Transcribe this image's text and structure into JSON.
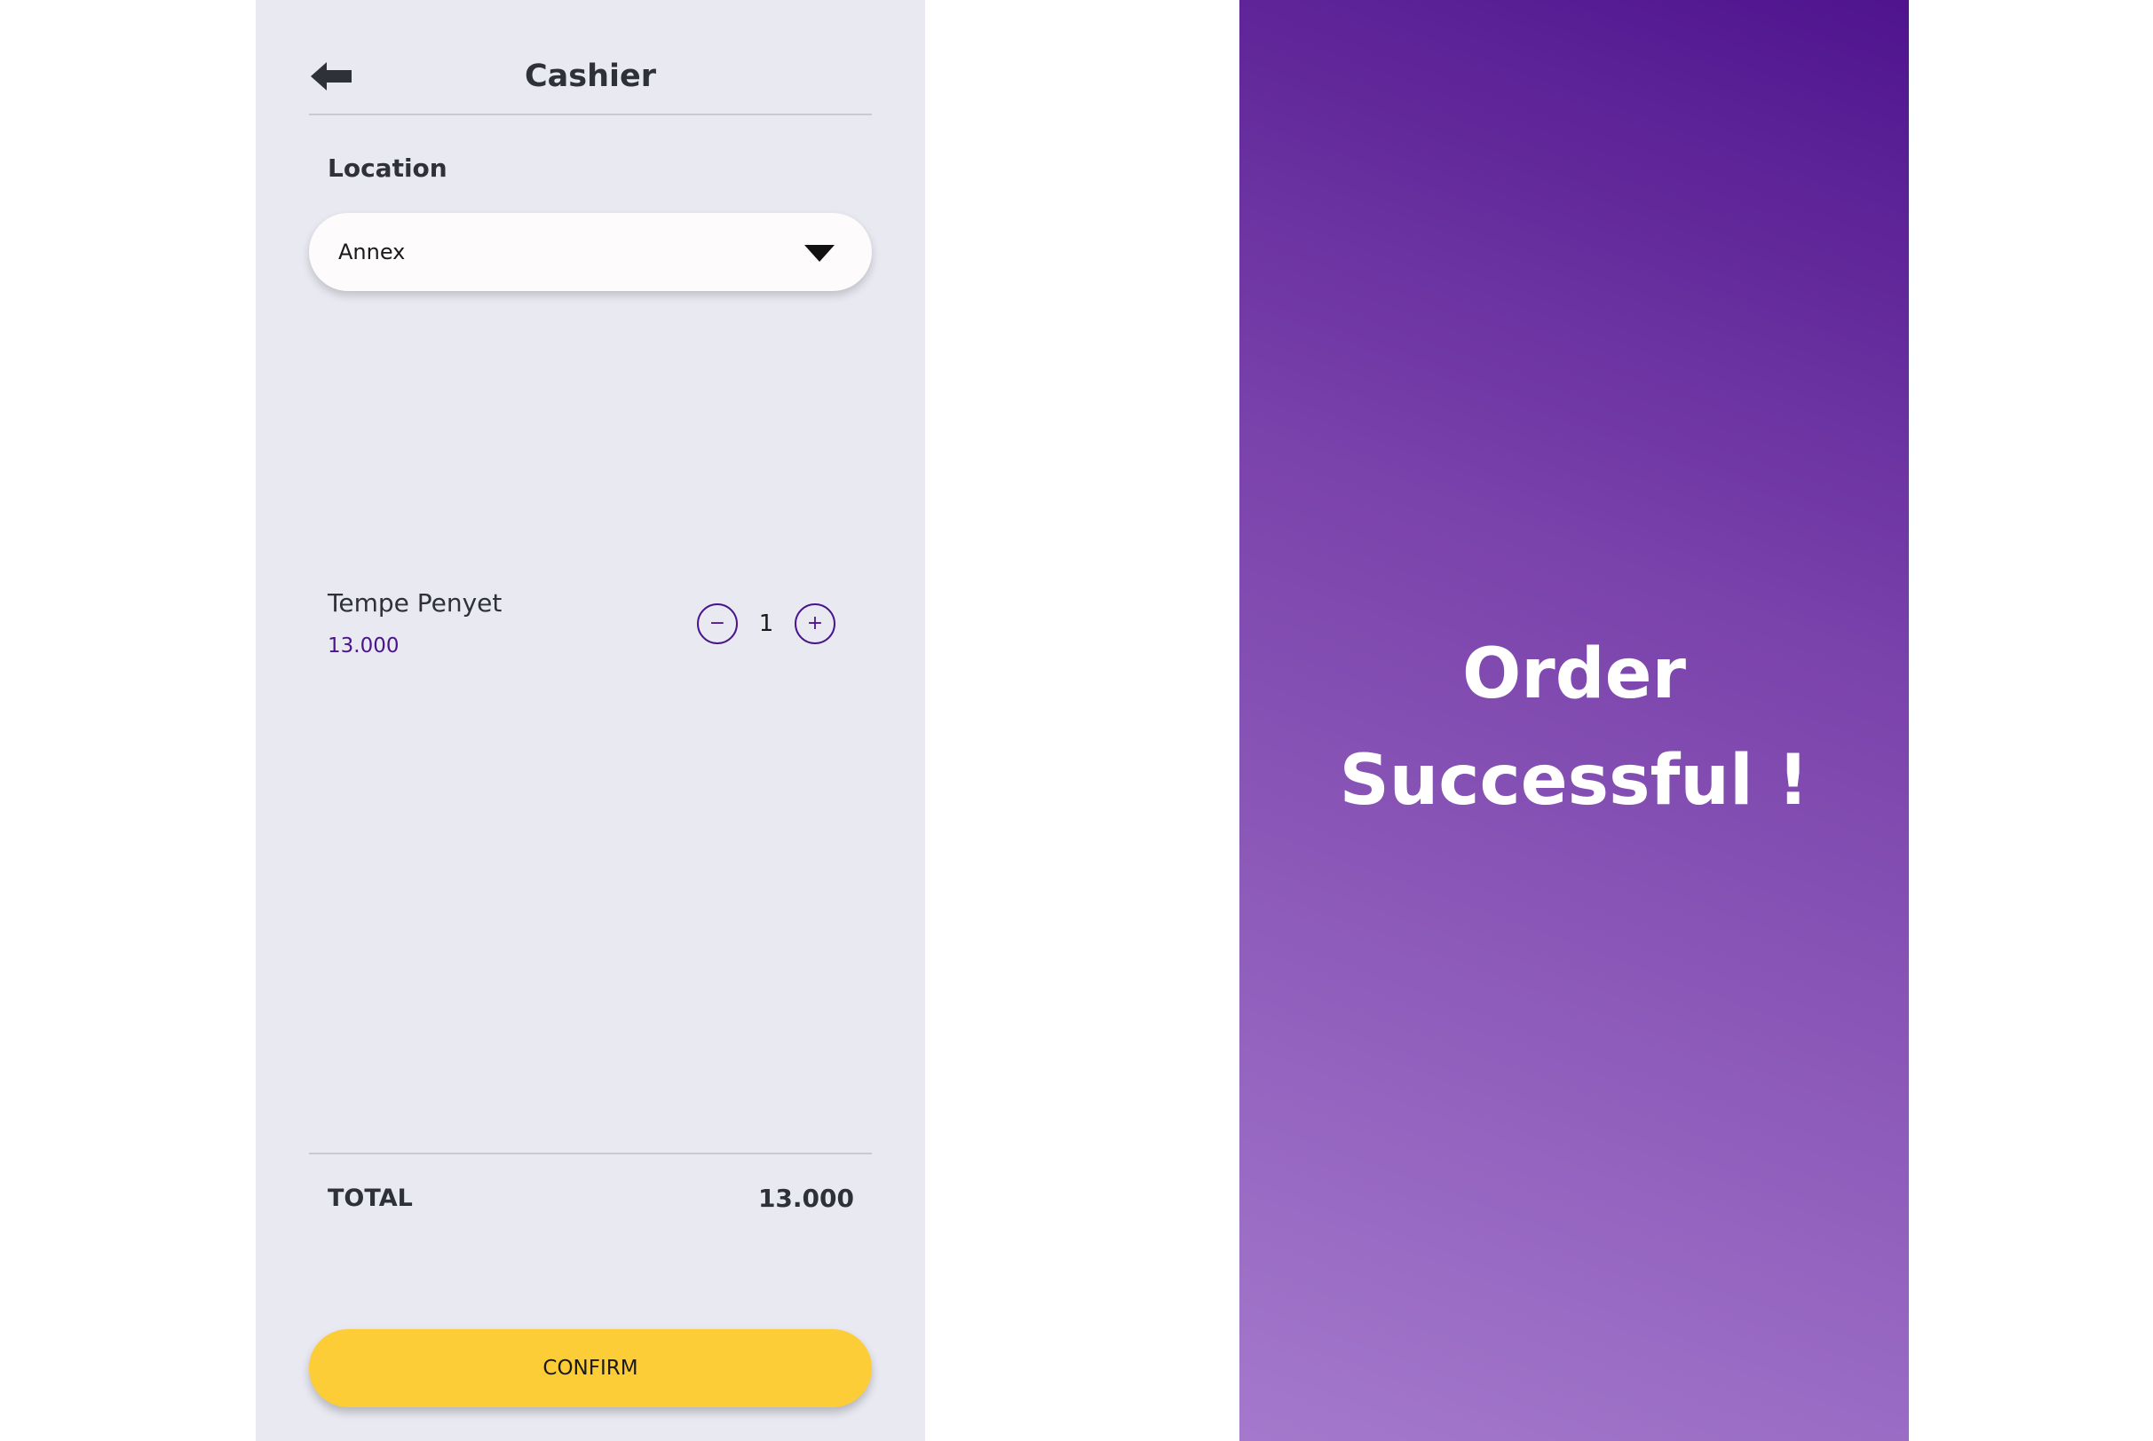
{
  "cashier": {
    "title": "Cashier",
    "back_icon": "arrow-left-icon",
    "location": {
      "label": "Location",
      "selected": "Annex",
      "dropdown_icon": "chevron-down-icon"
    },
    "items": [
      {
        "name": "Tempe Penyet",
        "price": "13.000",
        "quantity": "1",
        "decrement_label": "−",
        "increment_label": "+"
      }
    ],
    "total": {
      "label": "TOTAL",
      "value": "13.000"
    },
    "confirm_label": "CONFIRM"
  },
  "success": {
    "line1": "Order",
    "line2": "Successful !"
  },
  "colors": {
    "screen_bg": "#e9e9f2",
    "accent_purple": "#4a148c",
    "confirm_yellow": "#fdcd37",
    "gradient_top": "#4f148e",
    "gradient_bottom": "#a479cc"
  }
}
